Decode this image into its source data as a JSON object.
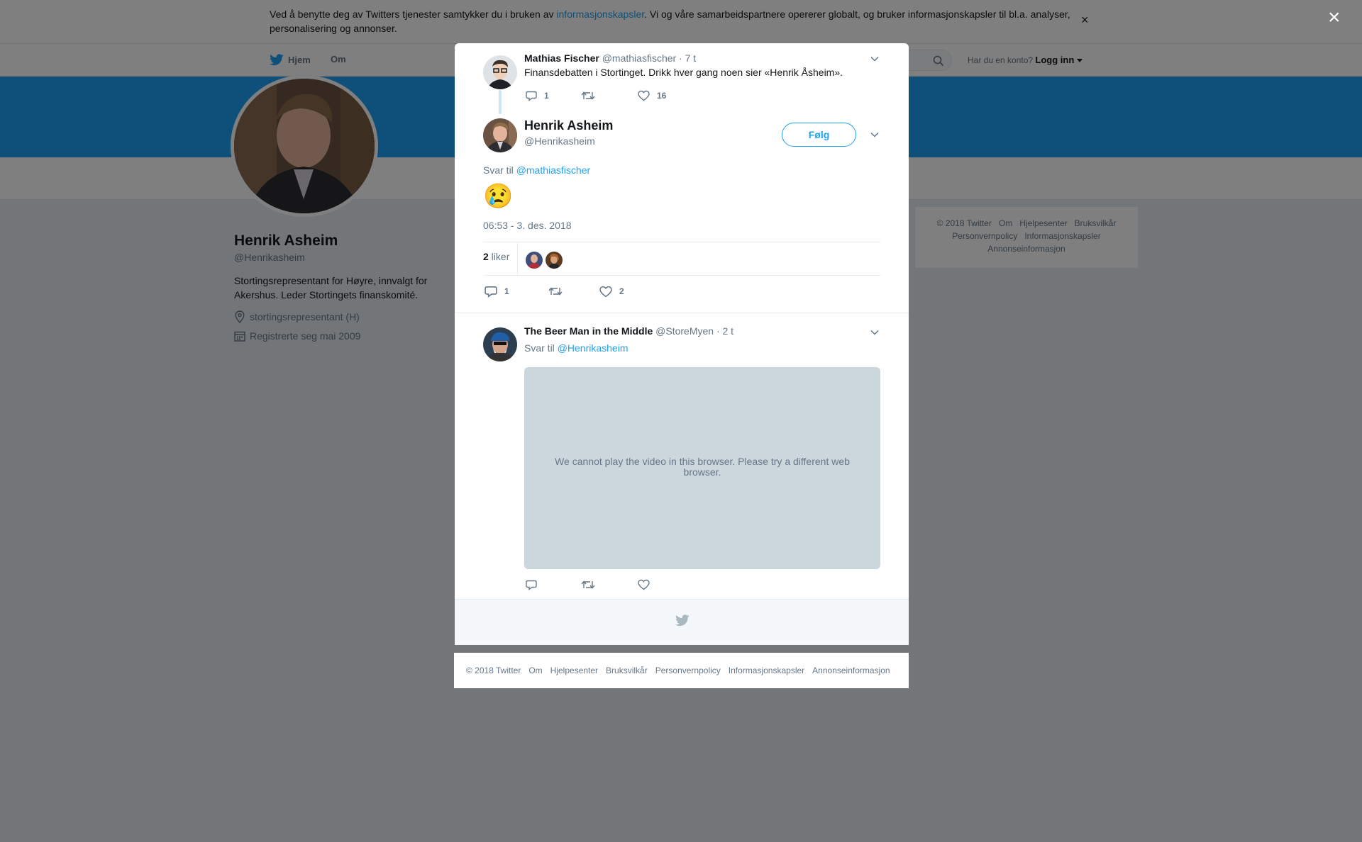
{
  "cookie_banner": {
    "text_before": "Ved å benytte deg av Twitters tjenester samtykker du i bruken av ",
    "link": "informasjonskapsler",
    "text_after": ". Vi og våre samarbeidspartnere opererer globalt, og bruker informasjonskapsler til bl.a. analyser, personalisering og annonser.",
    "close": "×"
  },
  "topnav": {
    "home": "Hjem",
    "about": "Om",
    "account_prompt": "Har du en konto?",
    "login": "Logg inn"
  },
  "profile": {
    "name": "Henrik Asheim",
    "handle": "@Henrikasheim",
    "bio": "Stortingsrepresentant for Høyre, innvalgt for Akershus. Leder Stortingets finanskomité.",
    "location": "stortingsrepresentant (H)",
    "joined": "Registrerte seg mai 2009"
  },
  "side_footer": {
    "row1": [
      "© 2018 Twitter",
      "Om",
      "Hjelpesenter",
      "Bruksvilkår"
    ],
    "row2": [
      "Personvernpolicy",
      "Informasjonskapsler"
    ],
    "row3": [
      "Annonseinformasjon"
    ]
  },
  "overlay": {
    "close": "×"
  },
  "modal": {
    "parent_tweet": {
      "name": "Mathias Fischer",
      "handle": "@mathiasfischer",
      "time": "· 7 t",
      "text": "Finansdebatten i Stortinget. Drikk hver gang noen sier «Henrik Åsheim».",
      "replies": "1",
      "retweets": "",
      "likes": "16"
    },
    "main_tweet": {
      "name": "Henrik Asheim",
      "handle": "@Henrikasheim",
      "follow": "Følg",
      "reply_prefix": "Svar til ",
      "reply_mention": "@mathiasfischer",
      "text": "😢",
      "timestamp": "06:53 - 3. des. 2018",
      "likes_number": "2",
      "likes_word": " liker",
      "replies": "1",
      "retweets": "",
      "likes": "2"
    },
    "reply_tweet": {
      "name": "The Beer Man in the Middle",
      "handle": "@StoreMyen",
      "time": "· 2 t",
      "reply_prefix": "Svar til ",
      "reply_mention": "@Henrikasheim",
      "video_message": "We cannot play the video in this browser. Please try a different web browser."
    }
  },
  "bottom_footer": [
    "© 2018 Twitter",
    "Om",
    "Hjelpesenter",
    "Bruksvilkår",
    "Personvernpolicy",
    "Informasjonskapsler",
    "Annonseinformasjon"
  ],
  "colors": {
    "accent": "#1da1f2",
    "overlay": "rgba(0,0,0,0.5)",
    "video_bg": "#ccd6dd",
    "muted_text": "#657786"
  },
  "icons": [
    "twitter-bird-icon",
    "search-icon",
    "close-icon",
    "location-icon",
    "calendar-icon",
    "reply-icon",
    "retweet-icon",
    "like-icon",
    "chevron-down-icon",
    "caret-down-icon"
  ]
}
